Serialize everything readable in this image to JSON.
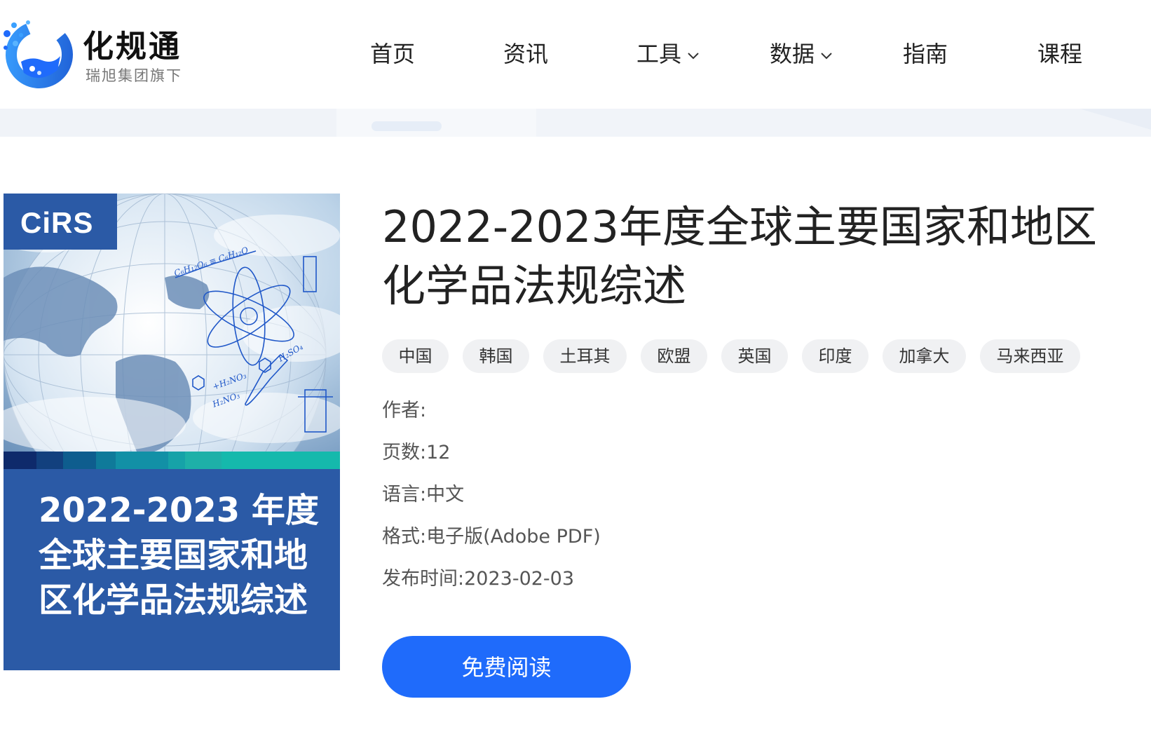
{
  "brand": {
    "name": "化规通",
    "subtitle": "瑞旭集团旗下"
  },
  "nav": {
    "items": [
      {
        "label": "首页",
        "has_dropdown": false
      },
      {
        "label": "资讯",
        "has_dropdown": false
      },
      {
        "label": "工具",
        "has_dropdown": true
      },
      {
        "label": "数据",
        "has_dropdown": true
      },
      {
        "label": "指南",
        "has_dropdown": false
      },
      {
        "label": "课程",
        "has_dropdown": false
      }
    ]
  },
  "cover": {
    "brand": "CiRS",
    "title_lines": [
      "2022-2023 年度",
      "全球主要国家和地",
      "区化学品法规综述"
    ]
  },
  "document": {
    "title": "2022-2023年度全球主要国家和地区化学品法规综述",
    "tags": [
      "中国",
      "韩国",
      "土耳其",
      "欧盟",
      "英国",
      "印度",
      "加拿大",
      "马来西亚"
    ],
    "meta": {
      "author_label": "作者:",
      "author_value": "",
      "pages_label": "页数:",
      "pages_value": "12",
      "language_label": "语言:",
      "language_value": "中文",
      "format_label": "格式:",
      "format_value": "电子版(Adobe PDF)",
      "published_label": "发布时间:",
      "published_value": "2023-02-03"
    },
    "read_button": "免费阅读"
  },
  "colors": {
    "accent": "#1f6bfb",
    "cover_blue": "#2b5aa6",
    "tag_bg": "#f0f1f3"
  }
}
